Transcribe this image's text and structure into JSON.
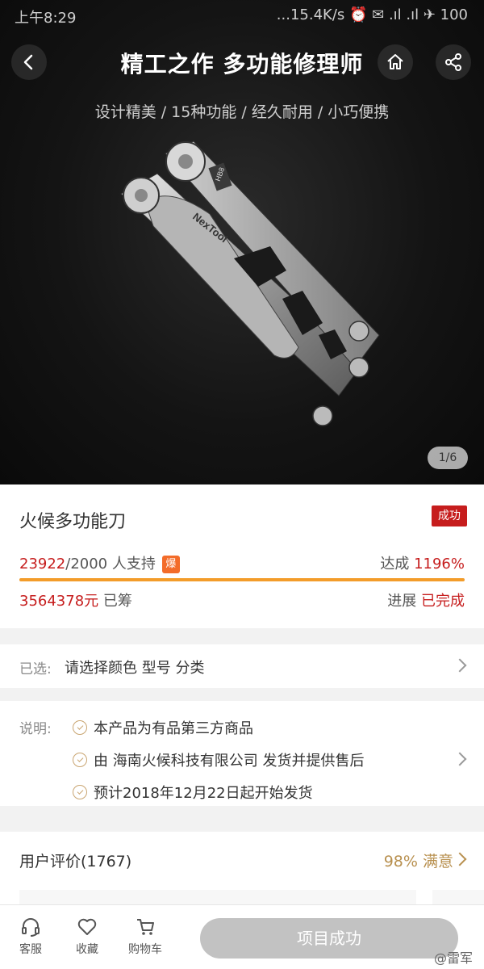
{
  "status": {
    "time": "上午8:29",
    "right": "...15.4K/s ⏰ ✉ .ıl .ıl ✈ 100"
  },
  "header": {
    "title": "精工之作 多功能修理师",
    "subtitle": "设计精美 / 15种功能 / 经久耐用 / 小巧便携",
    "page_indicator": "1/6",
    "image_text": [
      "NexTool",
      "HB8"
    ]
  },
  "product": {
    "name": "火候多功能刀",
    "badge": "成功",
    "supporters": "23922",
    "goal": "/2000 人支持",
    "hot": "爆",
    "rate_label": "达成",
    "rate_value": "1196%",
    "raised": "3564378元",
    "raised_suffix": "已筹",
    "progress_label": "进展",
    "progress_value": "已完成",
    "progress_fraction": 1.0
  },
  "select": {
    "label": "已选:",
    "value": "请选择颜色 型号 分类"
  },
  "notes": {
    "label": "说明:",
    "items": [
      "本产品为有品第三方商品",
      "由 海南火候科技有限公司 发货并提供售后",
      "预计2018年12月22日起开始发货"
    ]
  },
  "reviews": {
    "title": "用户评价(1767)",
    "rate": "98% 满意"
  },
  "bottom": {
    "service": "客服",
    "favorite": "收藏",
    "cart": "购物车",
    "cta": "项目成功",
    "watermark": "@雷军"
  },
  "colors": {
    "accent_red": "#c61d1d",
    "progress_orange": "#f39c2a",
    "gold": "#b8904f",
    "cta_gray": "#c2c2c2"
  }
}
